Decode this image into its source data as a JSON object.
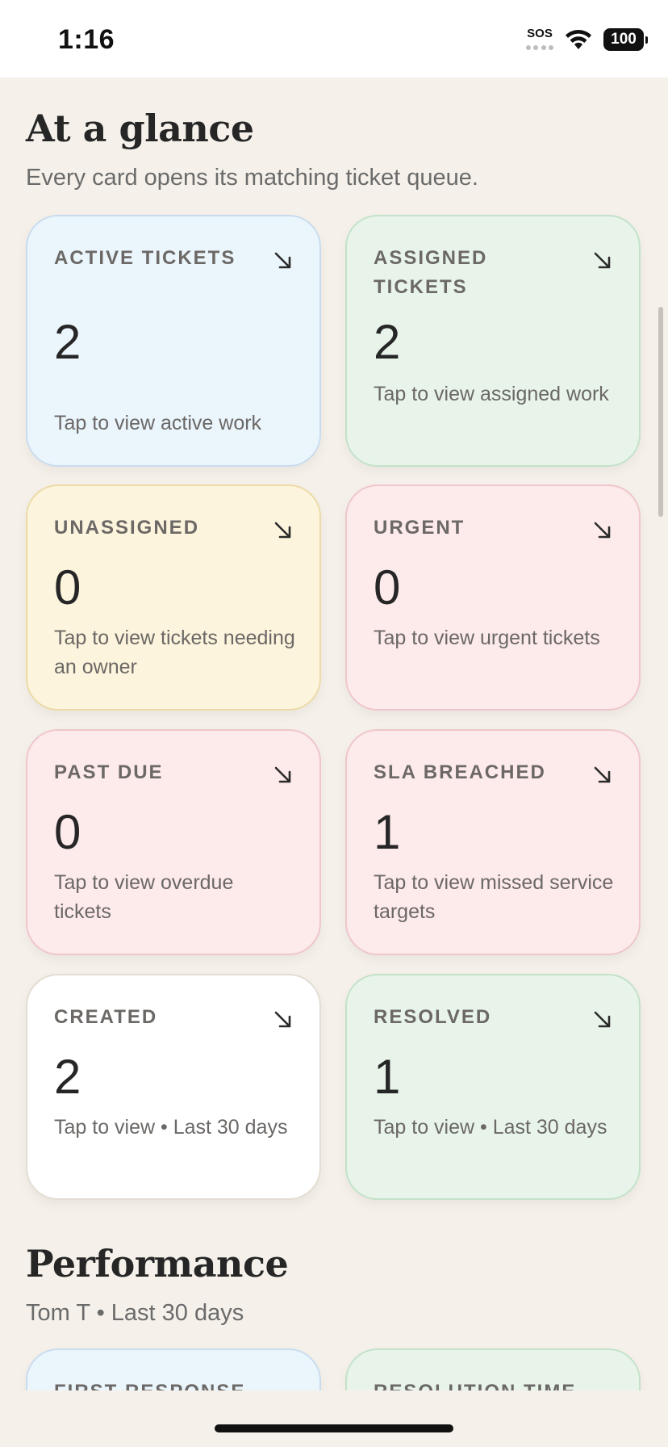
{
  "status_bar": {
    "time": "1:16",
    "sos": "SOS",
    "battery": "100"
  },
  "glance": {
    "title": "At a glance",
    "subtitle": "Every card opens its matching ticket queue.",
    "cards": [
      {
        "label": "ACTIVE TICKETS",
        "value": "2",
        "hint": "Tap to view active work"
      },
      {
        "label": "ASSIGNED TICKETS",
        "value": "2",
        "hint": "Tap to view assigned work"
      },
      {
        "label": "UNASSIGNED",
        "value": "0",
        "hint": "Tap to view tickets needing an owner"
      },
      {
        "label": "URGENT",
        "value": "0",
        "hint": "Tap to view urgent tickets"
      },
      {
        "label": "PAST DUE",
        "value": "0",
        "hint": "Tap to view overdue tickets"
      },
      {
        "label": "SLA BREACHED",
        "value": "1",
        "hint": "Tap to view missed service targets"
      },
      {
        "label": "CREATED",
        "value": "2",
        "hint": "Tap to view • Last 30 days"
      },
      {
        "label": "RESOLVED",
        "value": "1",
        "hint": "Tap to view • Last 30 days"
      }
    ]
  },
  "performance": {
    "title": "Performance",
    "subtitle": "Tom T • Last 30 days",
    "cards": [
      {
        "label": "FIRST RESPONSE"
      },
      {
        "label": "RESOLUTION TIME"
      }
    ]
  },
  "colors": {
    "blue": "#eaf5fc",
    "green": "#e8f4ea",
    "amber": "#fcf4dc",
    "rose": "#fdeaea",
    "white": "#ffffff"
  }
}
